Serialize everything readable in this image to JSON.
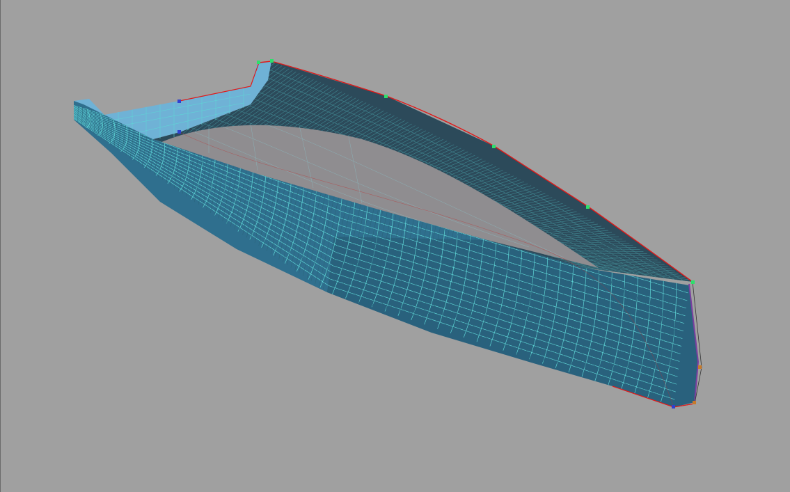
{
  "viewport": {
    "background_color": "#a0a0a0",
    "view_mode": "perspective-3d"
  },
  "model": {
    "type": "boat-hull-surface",
    "colors": {
      "hull_surface": "#2f6f8e",
      "hull_shadow": "#24566f",
      "interior_light": "#6fb2d6",
      "interior_deck": "#8f8d90",
      "mesh_lines": "#5fd6d6",
      "sheer_line": "#e01919",
      "control_point_green": "#2de06a",
      "control_point_blue": "#3040d0",
      "control_point_orange": "#c87a2a"
    }
  }
}
